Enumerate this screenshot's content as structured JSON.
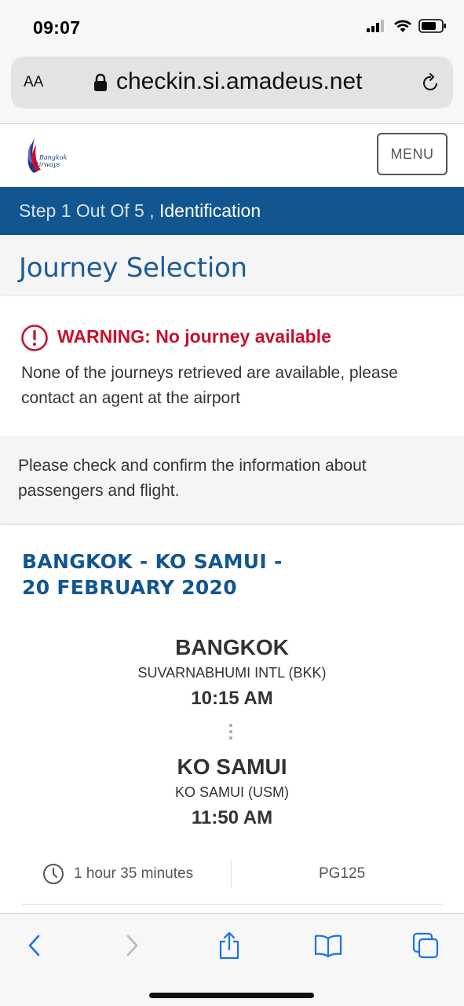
{
  "status_bar": {
    "time": "09:07"
  },
  "browser": {
    "text_size_label": "AA",
    "url": "checkin.si.amadeus.net"
  },
  "header": {
    "logo_text_line1": "Bangkok",
    "logo_text_line2": "Airways",
    "menu_label": "MENU"
  },
  "step": {
    "prefix": "Step 1 Out Of 5 , ",
    "name": "Identification"
  },
  "page_title": "Journey Selection",
  "warning": {
    "title": "WARNING: No journey available",
    "body": "None of the journeys retrieved are available, please contact an agent at the airport"
  },
  "info_text": "Please check and confirm the information about passengers and flight.",
  "journey": {
    "heading_line1": "BANGKOK - KO SAMUI -",
    "heading_line2": "20 FEBRUARY 2020",
    "departure": {
      "city": "BANGKOK",
      "airport": "SUVARNABHUMI INTL (BKK)",
      "time": "10:15 AM"
    },
    "arrival": {
      "city": "KO SAMUI",
      "airport": "KO SAMUI (USM)",
      "time": "11:50 AM"
    },
    "duration": "1 hour 35 minutes",
    "flight_number": "PG125"
  },
  "colors": {
    "brand_blue": "#125691",
    "warning_red": "#c8102e",
    "ios_blue": "#1a73e8"
  }
}
